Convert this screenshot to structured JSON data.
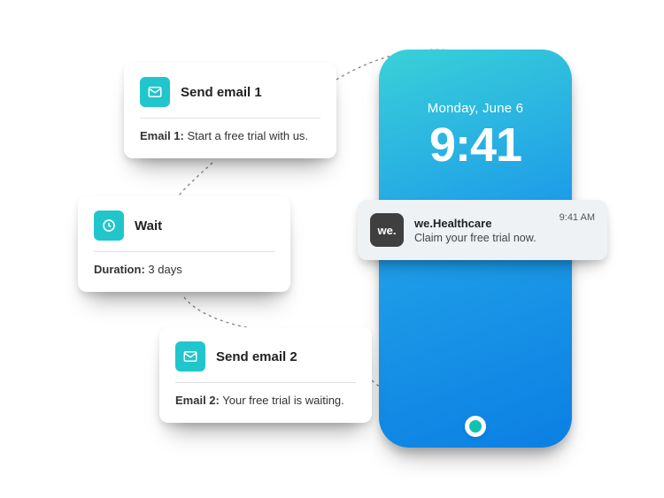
{
  "workflow": {
    "step1": {
      "title": "Send email 1",
      "detail_label": "Email 1:",
      "detail_value": "Start a free trial with us."
    },
    "step2": {
      "title": "Wait",
      "detail_label": "Duration:",
      "detail_value": "3 days"
    },
    "step3": {
      "title": "Send email 2",
      "detail_label": "Email 2:",
      "detail_value": "Your free trial is waiting."
    }
  },
  "phone": {
    "date": "Monday, June 6",
    "time": "9:41"
  },
  "notification": {
    "app_icon_text": "we.",
    "app_name": "we.Healthcare",
    "message": "Claim your free trial now.",
    "time": "9:41 AM"
  }
}
